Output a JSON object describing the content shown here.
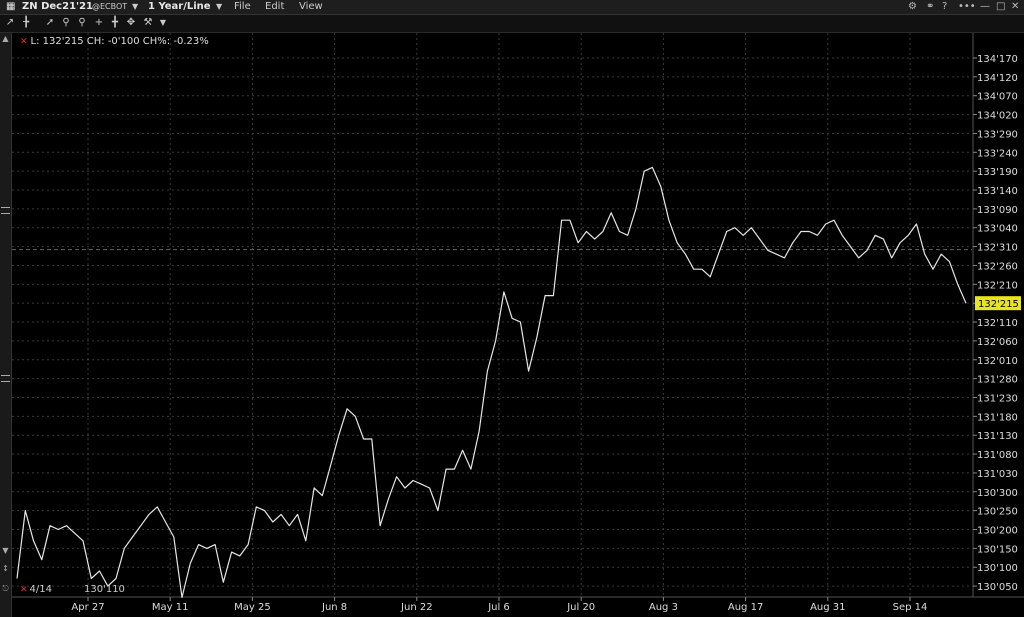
{
  "window": {
    "symbol": "ZN Dec21'21",
    "exchange": "@ECBOT",
    "period": "1 Year/Line",
    "menu": [
      "File",
      "Edit",
      "View"
    ]
  },
  "legend": {
    "text": "L: 132'215 CH: -0'100 CH%: -0.23%"
  },
  "bottom_info": {
    "date": "4/14",
    "value": "130'110"
  },
  "colors": {
    "background": "#000000",
    "line": "#e6e6e6",
    "grid": "#3a3a3a",
    "last_price_tag": "#e8e61a"
  },
  "chart_data": {
    "type": "line",
    "x_ticks": [
      "Apr 27",
      "May 11",
      "May 25",
      "Jun 8",
      "Jun 22",
      "Jul 6",
      "Jul 20",
      "Aug 3",
      "Aug 17",
      "Aug 31",
      "Sep 14"
    ],
    "y_ticks": [
      "134'170",
      "134'120",
      "134'070",
      "134'020",
      "133'290",
      "133'240",
      "133'190",
      "133'140",
      "133'090",
      "133'040",
      "132'310",
      "132'260",
      "132'210",
      "132'160",
      "132'110",
      "132'060",
      "132'010",
      "131'280",
      "131'230",
      "131'180",
      "131'130",
      "131'080",
      "131'030",
      "130'300",
      "130'250",
      "130'200",
      "130'150",
      "130'100",
      "130'050"
    ],
    "last_value_label": "132'215",
    "reference_line_value": "132'310",
    "grid": true,
    "series": [
      {
        "values_32nds": [
          4167,
          4185,
          4177,
          4172,
          4181,
          4180,
          4181,
          4179,
          4177,
          4167,
          4169,
          4165,
          4167,
          4175,
          4178,
          4181,
          4184,
          4186,
          4182,
          4178,
          4162,
          4171,
          4176,
          4175,
          4176,
          4166,
          4174,
          4173,
          4176,
          4186,
          4185,
          4182,
          4184,
          4181,
          4184,
          4177,
          4191,
          4189,
          4197,
          4205,
          4212,
          4210,
          4204,
          4204,
          4181,
          4188,
          4194,
          4191,
          4193,
          4192,
          4191,
          4185,
          4196,
          4196,
          4201,
          4196,
          4206,
          4222,
          4230,
          4243,
          4236,
          4235,
          4222,
          4231,
          4242,
          4242,
          4262,
          4262,
          4256,
          4259,
          4257,
          4259,
          4264,
          4259,
          4258,
          4265,
          4275,
          4276,
          4271,
          4262,
          4256,
          4253,
          4249,
          4249,
          4247,
          4253,
          4259,
          4260,
          4258,
          4260,
          4257,
          4254,
          4253,
          4252,
          4256,
          4259,
          4259,
          4258,
          4261,
          4262,
          4258,
          4255,
          4252,
          4254,
          4258,
          4257,
          4252,
          4256,
          4258,
          4261,
          4253,
          4249,
          4253,
          4251,
          4245,
          4240
        ]
      }
    ]
  }
}
